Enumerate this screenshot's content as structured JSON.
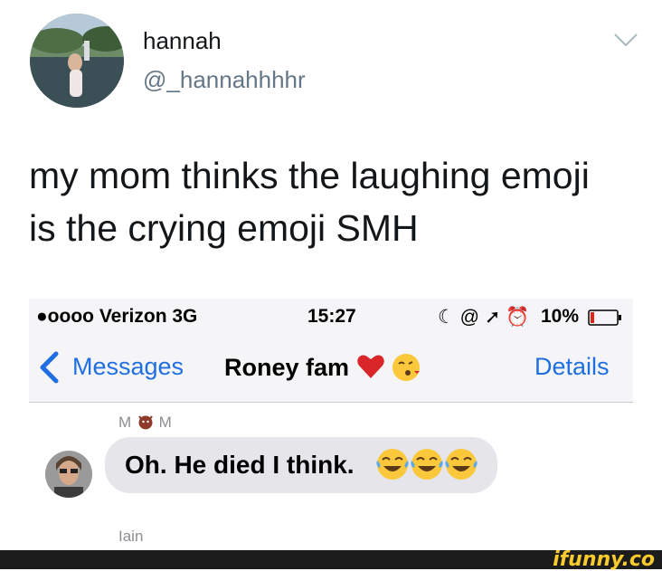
{
  "tweet": {
    "name": "hannah",
    "handle": "@_hannahhhhr",
    "text_line1": "my mom thinks the laughing emoji",
    "text_line2": "is the crying emoji SMH"
  },
  "phone": {
    "status": {
      "carrier": "●oooo Verizon  3G",
      "time": "15:27",
      "icons": "☾ @ ➚ ⏰",
      "battery": "10%"
    },
    "nav": {
      "back_label": "Messages",
      "title": "Roney fam",
      "details": "Details"
    },
    "sender": "M M",
    "message": "Oh. He died I think.",
    "next_sender": "Iain"
  },
  "footer": {
    "brand": "ifunny.co"
  },
  "colors": {
    "ios_blue": "#1f6fe0",
    "bubble": "#e5e5ea",
    "handle_grey": "#657786",
    "brand_yellow": "#f9cb2c"
  }
}
